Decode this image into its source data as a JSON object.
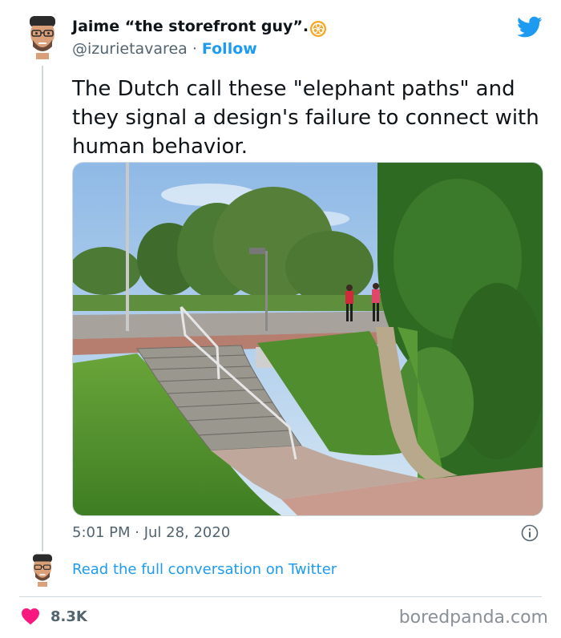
{
  "author": {
    "name": "Jaime “the storefront guy”.",
    "handle": "@izurietavarea",
    "separator": "·",
    "follow_label": "Follow",
    "badge_icon": "biohazard-badge-icon",
    "avatar_icon": "avatar-face-icon"
  },
  "brand_icon": "twitter-bird-icon",
  "tweet": {
    "text": "The Dutch call these \"elephant paths\" and they signal a design's failure to connect with human behavior.",
    "photo_icon": "photo-stairs-elephant-path"
  },
  "meta": {
    "timestamp": "5:01 PM · Jul 28, 2020",
    "info_icon": "info-icon"
  },
  "conversation": {
    "label": "Read the full conversation on Twitter"
  },
  "footer": {
    "likes": "8.3K",
    "heart_icon": "heart-icon",
    "watermark": "boredpanda.com"
  },
  "colors": {
    "accent": "#1d9bf0",
    "muted_text": "#536471",
    "heart": "#f91880",
    "divider": "#cfd9de"
  }
}
